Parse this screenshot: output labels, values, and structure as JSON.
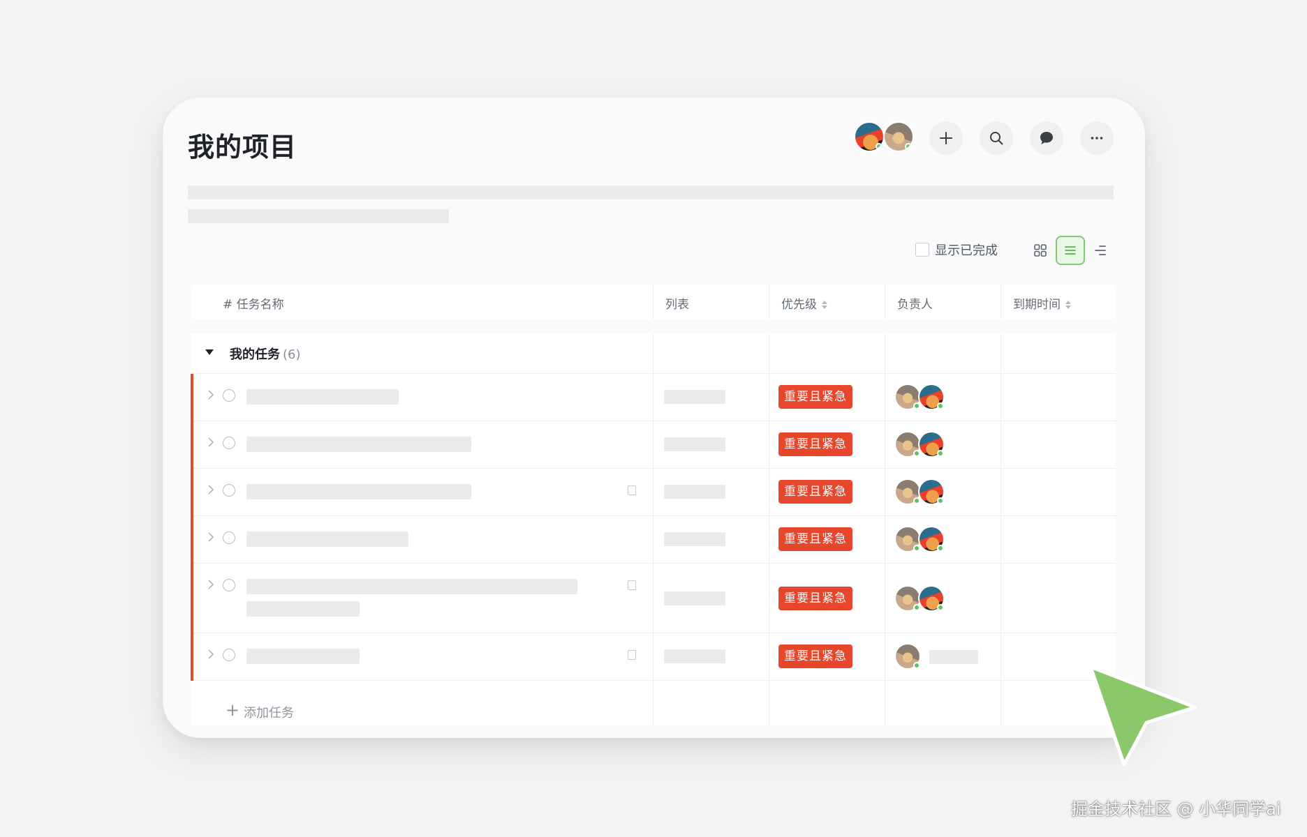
{
  "header": {
    "title": "我的项目",
    "members": [
      {
        "avatar": "member-avatar-1",
        "online": true
      },
      {
        "avatar": "member-avatar-2",
        "online": true
      }
    ],
    "buttons": {
      "add": "plus-icon",
      "search": "search-icon",
      "chat": "chat-icon",
      "more": "more-icon"
    }
  },
  "toolbar": {
    "show_completed_label": "显示已完成",
    "show_completed_checked": false,
    "views": [
      "board-view-icon",
      "list-view-icon",
      "gantt-view-icon"
    ],
    "active_view": "list-view-icon"
  },
  "table": {
    "columns": {
      "name": "# 任务名称",
      "list": "列表",
      "priority": "优先级",
      "assignee": "负责人",
      "due": "到期时间"
    },
    "group": {
      "label": "我的任务",
      "count": "(6)",
      "expanded": true
    },
    "rows": [
      {
        "priority": "重要且紧急",
        "has_doc": false
      },
      {
        "priority": "重要且紧急",
        "has_doc": false
      },
      {
        "priority": "重要且紧急",
        "has_doc": true
      },
      {
        "priority": "重要且紧急",
        "has_doc": false
      },
      {
        "priority": "重要且紧急",
        "has_doc": true
      },
      {
        "priority": "重要且紧急",
        "has_doc": true
      }
    ],
    "add_task_label": "添加任务"
  },
  "colors": {
    "accent_green": "#5bb24d",
    "priority_red": "#e8452d",
    "row_marker": "#e34a2f"
  },
  "watermark": "掘金技术社区 @ 小华同学ai"
}
